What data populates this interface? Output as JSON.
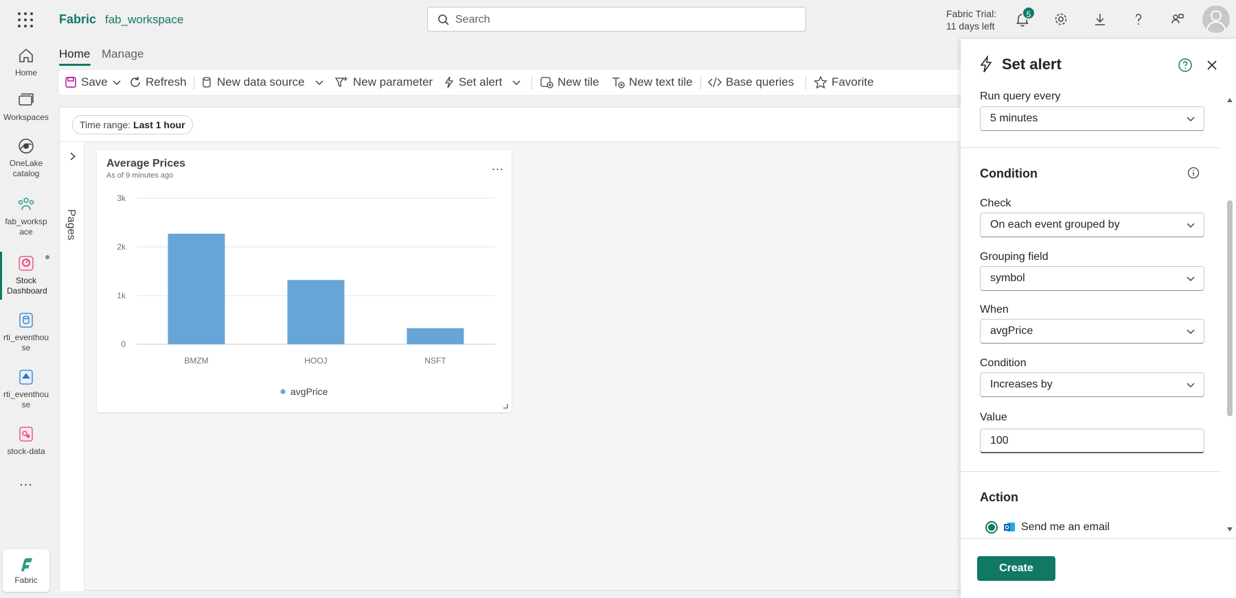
{
  "topbar": {
    "brand": "Fabric",
    "workspace": "fab_workspace",
    "search_placeholder": "Search",
    "trial_line1": "Fabric Trial:",
    "trial_line2": "11 days left",
    "notification_count": "5"
  },
  "leftnav": {
    "items": [
      {
        "label": "Home",
        "icon": "home-icon"
      },
      {
        "label": "Workspaces",
        "icon": "workspaces-icon"
      },
      {
        "label": "OneLake catalog",
        "icon": "onelake-icon"
      },
      {
        "label": "fab_workspace",
        "icon": "workspace-group-icon"
      },
      {
        "label": "Stock Dashboard",
        "icon": "dashboard-icon"
      },
      {
        "label": "rti_eventhouse",
        "icon": "eventhouse-icon"
      },
      {
        "label": "rti_eventhouse",
        "icon": "eventhouse-icon"
      },
      {
        "label": "stock-data",
        "icon": "eventstream-icon"
      }
    ],
    "more_label": "...",
    "fabric_label": "Fabric"
  },
  "main": {
    "tabs": [
      "Home",
      "Manage"
    ],
    "toolbar": {
      "save": "Save",
      "refresh": "Refresh",
      "new_data_source": "New data source",
      "new_parameter": "New parameter",
      "set_alert": "Set alert",
      "new_tile": "New tile",
      "new_text_tile": "New text tile",
      "base_queries": "Base queries",
      "favorite": "Favorite"
    },
    "time_range_label": "Time range:",
    "time_range_value": "Last 1 hour",
    "pages_label": "Pages"
  },
  "tile": {
    "title": "Average Prices",
    "subtitle": "As of 9 minutes ago",
    "more": "...",
    "chart_data": {
      "type": "bar",
      "categories": [
        "BMZM",
        "HOOJ",
        "NSFT"
      ],
      "series": [
        {
          "name": "avgPrice",
          "values": [
            2270,
            1320,
            330
          ],
          "color": "#65a5d8"
        }
      ],
      "ylim": [
        0,
        3000
      ],
      "yticks": [
        0,
        1000,
        2000,
        3000
      ],
      "ytick_labels": [
        "0",
        "1k",
        "2k",
        "3k"
      ],
      "grid": true,
      "legend": "bottom-center"
    }
  },
  "panel": {
    "title": "Set alert",
    "run_query_label": "Run query every",
    "run_query_value": "5 minutes",
    "condition_section": "Condition",
    "check_label": "Check",
    "check_value": "On each event grouped by",
    "grouping_label": "Grouping field",
    "grouping_value": "symbol",
    "when_label": "When",
    "when_value": "avgPrice",
    "condition_label": "Condition",
    "condition_value": "Increases by",
    "value_label": "Value",
    "value_value": "100",
    "action_section": "Action",
    "action_option": "Send me an email",
    "create_label": "Create"
  }
}
